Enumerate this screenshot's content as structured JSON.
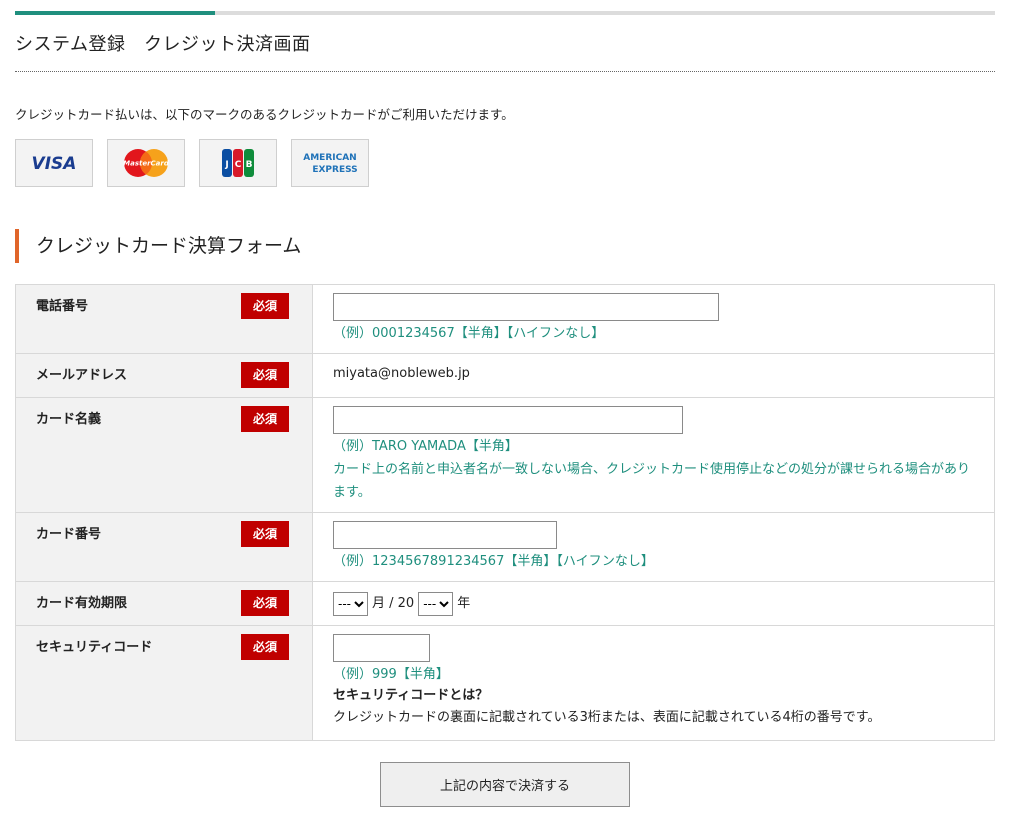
{
  "progress": {
    "value_fraction": 0.204,
    "fill_color": "#1f8f7e",
    "track_color": "#dcdcdc"
  },
  "page_title": "システム登録　クレジット決済画面",
  "intro": "クレジットカード払いは、以下のマークのあるクレジットカードがご利用いただけます。",
  "cards": [
    {
      "name": "VISA",
      "icon": "visa-logo"
    },
    {
      "name": "MasterCard",
      "icon": "mastercard-logo"
    },
    {
      "name": "JCB",
      "icon": "jcb-logo"
    },
    {
      "name": "AMERICAN EXPRESS",
      "icon": "amex-logo"
    }
  ],
  "section_title": "クレジットカード決算フォーム",
  "required_label": "必須",
  "form": {
    "phone": {
      "label": "電話番号",
      "value": "",
      "hint": "（例）0001234567【半角】【ハイフンなし】"
    },
    "email": {
      "label": "メールアドレス",
      "value": "miyata@nobleweb.jp"
    },
    "card_name": {
      "label": "カード名義",
      "value": "",
      "hint": "（例）TARO YAMADA【半角】",
      "note": "カード上の名前と申込者名が一致しない場合、クレジットカード使用停止などの処分が課せられる場合があります。"
    },
    "card_number": {
      "label": "カード番号",
      "value": "",
      "hint": "（例）1234567891234567【半角】【ハイフンなし】"
    },
    "expiry": {
      "label": "カード有効期限",
      "month_value": "---",
      "month_unit": "月 / 20",
      "year_value": "---",
      "year_unit": "年"
    },
    "security": {
      "label": "セキュリティコード",
      "value": "",
      "hint": "（例）999【半角】",
      "what_title": "セキュリティコードとは？",
      "what_text": "クレジットカードの裏面に記載されている3桁または、表面に記載されている4桁の番号です。"
    }
  },
  "submit_label": "上記の内容で決済する",
  "colors": {
    "accent": "#1f8f7e",
    "required_bg": "#c00000",
    "section_bar": "#e0652a"
  }
}
